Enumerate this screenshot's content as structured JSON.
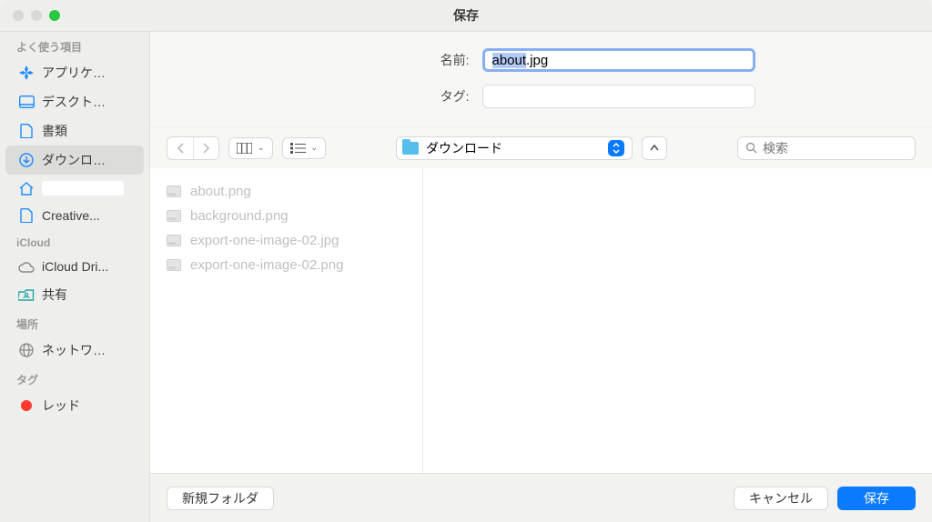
{
  "window": {
    "title": "保存"
  },
  "form": {
    "name_label": "名前:",
    "name_value": "about.jpg",
    "tags_label": "タグ:"
  },
  "toolbar": {
    "location_label": "ダウンロード",
    "search_placeholder": "検索"
  },
  "sidebar": {
    "favorites_header": "よく使う項目",
    "favorites": [
      {
        "icon": "app",
        "label": "アプリケ…"
      },
      {
        "icon": "desktop",
        "label": "デスクト…"
      },
      {
        "icon": "documents",
        "label": "書類"
      },
      {
        "icon": "downloads",
        "label": "ダウンロ…",
        "active": true
      },
      {
        "icon": "home",
        "label": ""
      },
      {
        "icon": "folder",
        "label": "Creative..."
      }
    ],
    "icloud_header": "iCloud",
    "icloud": [
      {
        "icon": "cloud",
        "label": "iCloud Dri..."
      },
      {
        "icon": "shared",
        "label": "共有"
      }
    ],
    "locations_header": "場所",
    "locations": [
      {
        "icon": "network",
        "label": "ネットワ…"
      }
    ],
    "tags_header": "タグ",
    "tags": [
      {
        "color": "#ff3b30",
        "label": "レッド"
      }
    ]
  },
  "files": [
    {
      "name": "about.png"
    },
    {
      "name": "background.png"
    },
    {
      "name": "export-one-image-02.jpg"
    },
    {
      "name": "export-one-image-02.png"
    }
  ],
  "footer": {
    "new_folder": "新規フォルダ",
    "cancel": "キャンセル",
    "save": "保存"
  }
}
